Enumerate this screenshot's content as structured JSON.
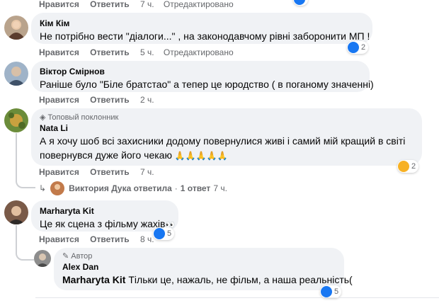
{
  "colors": {
    "like_blue": "#1877f2",
    "meta_gray": "#65676b",
    "bubble_bg": "#f0f2f5"
  },
  "top_partial": {
    "like": "Нравится",
    "reply": "Ответить",
    "time": "7 ч.",
    "edited": "Отредактировано"
  },
  "comments": [
    {
      "author": "Кім Кім",
      "text": "Не потрібно вести \"діалоги...\" , на законодавчому рівні заборонити МП !",
      "like": "Нравится",
      "reply": "Ответить",
      "time": "5 ч.",
      "edited": "Отредактировано",
      "reactions": {
        "icon": "like-icon",
        "count": "2"
      }
    },
    {
      "author": "Віктор Смірнов",
      "text": "Раніше було \"Біле братстао\" а тепер це юродство ( в поганому значенні)",
      "like": "Нравится",
      "reply": "Ответить",
      "time": "2 ч."
    },
    {
      "badge": "Топовый поклонник",
      "badge_icon": "diamond-icon",
      "author": "Nata Li",
      "text_line1": "А я хочу шоб всі захисники додому повернулися живі і самий мій кращий в світі",
      "text_line2": "повернувся дуже його чекаю",
      "emoji": "🙏🙏🙏🙏🙏",
      "like": "Нравится",
      "reply": "Ответить",
      "time": "7 ч.",
      "reactions": {
        "icon": "care-icon",
        "count": "2"
      },
      "replies_summary": {
        "name": "Виктория Дука ответила",
        "sep": "·",
        "count": "1 ответ",
        "time": "7 ч."
      }
    },
    {
      "author": "Marharyta Kit",
      "text": "Це як сцена з фільму жахів",
      "emoji": "👀",
      "like": "Нравится",
      "reply": "Ответить",
      "time": "8 ч.",
      "reactions": {
        "icon": "like-icon",
        "count": "5"
      },
      "reply_item": {
        "badge": "Автор",
        "badge_icon": "pencil-icon",
        "author": "Alex Dan",
        "mention": "Marharyta Kit",
        "text": " Тільки це, нажаль, не фільм, а наша реальність(",
        "reactions": {
          "icon": "like-icon",
          "count": "5"
        }
      }
    }
  ]
}
